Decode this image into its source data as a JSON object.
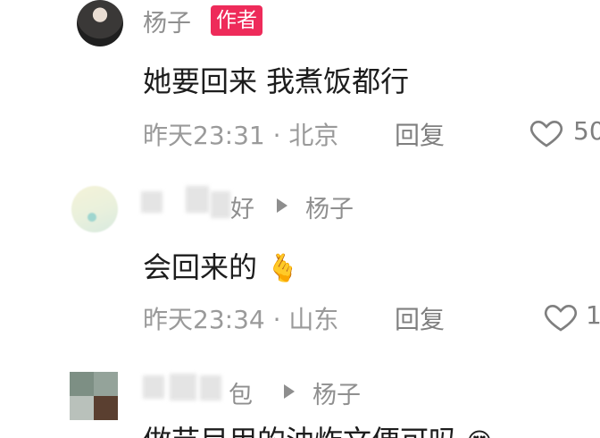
{
  "comments": [
    {
      "username": "杨子",
      "badge": "作者",
      "text": "她要回来 我煮饭都行",
      "time": "昨天23:31",
      "location": "北京",
      "separator": "·",
      "reply_label": "回复",
      "likes": "50"
    },
    {
      "username_fragment": "好",
      "reply_to": "杨子",
      "text": "会回来的",
      "emoji": "🫰",
      "time": "昨天23:34",
      "location": "山东",
      "separator": "·",
      "reply_label": "回复",
      "likes": "1"
    },
    {
      "username_fragment": "包",
      "reply_to": "杨子",
      "text_partial": "做节目用的油炸文便可吗",
      "emoji": "😍"
    }
  ],
  "colors": {
    "badge_bg": "#ee2b5a",
    "username": "#8f8f8f",
    "content": "#1c1c1c",
    "meta": "#9a9a9a"
  },
  "icons": [
    "heart-outline-icon",
    "reply-arrow-icon",
    "finger-heart-emoji",
    "heart-eyes-emoji"
  ]
}
